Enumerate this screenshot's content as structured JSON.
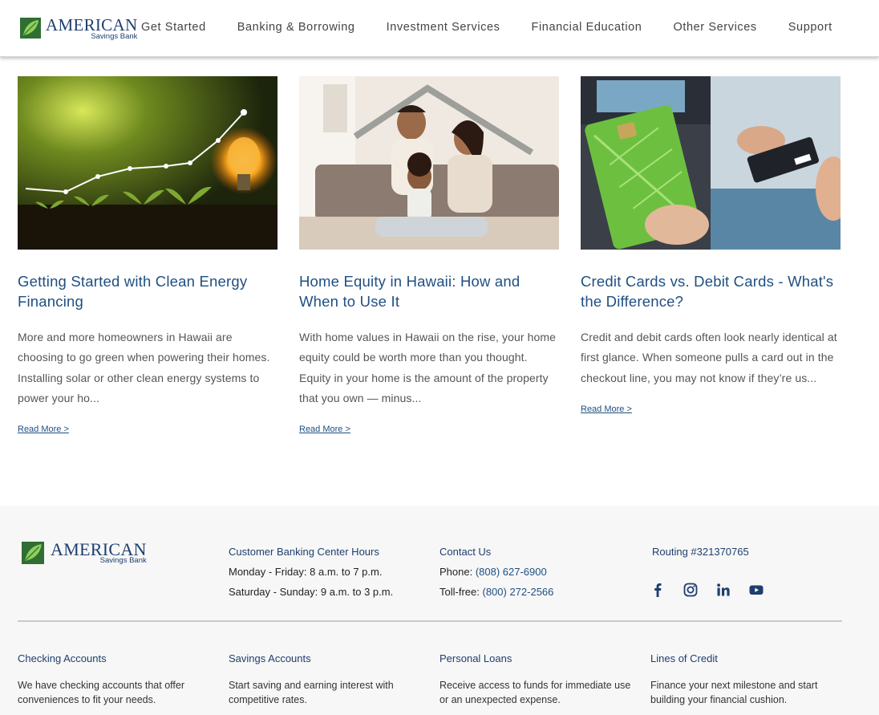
{
  "header": {
    "logo": {
      "word": "AMERICAN",
      "sub": "Savings Bank"
    },
    "nav": [
      {
        "label": "Get Started"
      },
      {
        "label": "Banking & Borrowing"
      },
      {
        "label": "Investment Services"
      },
      {
        "label": "Financial Education"
      },
      {
        "label": "Other Services"
      },
      {
        "label": "Support"
      }
    ]
  },
  "cards": [
    {
      "title": "Getting Started with Clean Energy Financing",
      "body": "More and more homeowners in Hawaii are choosing to go green when powering their homes. Installing solar or other clean energy systems to power your ho...",
      "link": "Read More >",
      "image": "lightbulb-growing-plants-image"
    },
    {
      "title": "Home Equity in Hawaii: How and When to Use It",
      "body": "With home values in Hawaii on the rise, your home equity could be worth more than you thought. Equity in your home is the amount of the property that you own — minus...",
      "link": "Read More >",
      "image": "family-under-roof-image"
    },
    {
      "title": "Credit Cards vs. Debit Cards - What's the Difference?",
      "body": "Credit and debit cards often look nearly identical at first glance. When someone pulls a card out in the checkout line, you may not know if they’re us...",
      "link": "Read More >",
      "image": "credit-debit-cards-image"
    }
  ],
  "footer": {
    "logo": {
      "word": "AMERICAN",
      "sub": "Savings Bank"
    },
    "hours": {
      "heading": "Customer Banking Center Hours",
      "weekdays": "Monday - Friday: 8 a.m. to 7 p.m.",
      "weekend": "Saturday - Sunday: 9 a.m. to 3 p.m."
    },
    "contact": {
      "heading": "Contact Us",
      "phone_label": "Phone:",
      "phone": "(808) 627-6900",
      "tollfree_label": "Toll-free:",
      "tollfree": "(800) 272-2566"
    },
    "routing": "Routing #321370765",
    "social": [
      "facebook-icon",
      "instagram-icon",
      "linkedin-icon",
      "youtube-icon"
    ],
    "categories": [
      {
        "title": "Checking Accounts",
        "desc": "We have checking accounts that offer conveniences to fit your needs."
      },
      {
        "title": "Savings Accounts",
        "desc": "Start saving and earning interest with competitive rates."
      },
      {
        "title": "Personal Loans",
        "desc": "Receive access to funds for immediate use or an unexpected expense."
      },
      {
        "title": "Lines of Credit",
        "desc": "Finance your next milestone and start building your financial cushion."
      }
    ]
  },
  "colors": {
    "brand_navy": "#1e3f6e",
    "link_blue": "#1f4f82",
    "brand_green": "#3e8a3a",
    "footer_bg": "#f7f7f7"
  }
}
